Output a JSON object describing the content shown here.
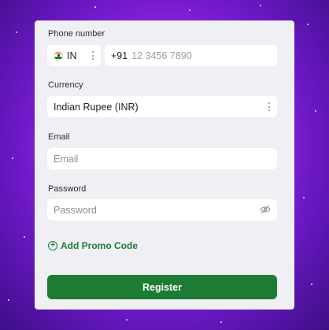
{
  "form": {
    "phone": {
      "label": "Phone number",
      "country_code_short": "IN",
      "dial_code": "+91",
      "placeholder": "12 3456 7890"
    },
    "currency": {
      "label": "Currency",
      "selected": "Indian Rupee (INR)"
    },
    "email": {
      "label": "Email",
      "placeholder": "Email"
    },
    "password": {
      "label": "Password",
      "placeholder": "Password"
    },
    "promo_label": "Add Promo Code",
    "register_label": "Register"
  },
  "colors": {
    "accent": "#1e7b34",
    "card_bg": "#eef0f4",
    "background_purple": "#9b25e6"
  },
  "icons": [
    "india-flag-icon",
    "kebab-menu-icon",
    "eye-slash-icon",
    "plus-circle-icon"
  ]
}
